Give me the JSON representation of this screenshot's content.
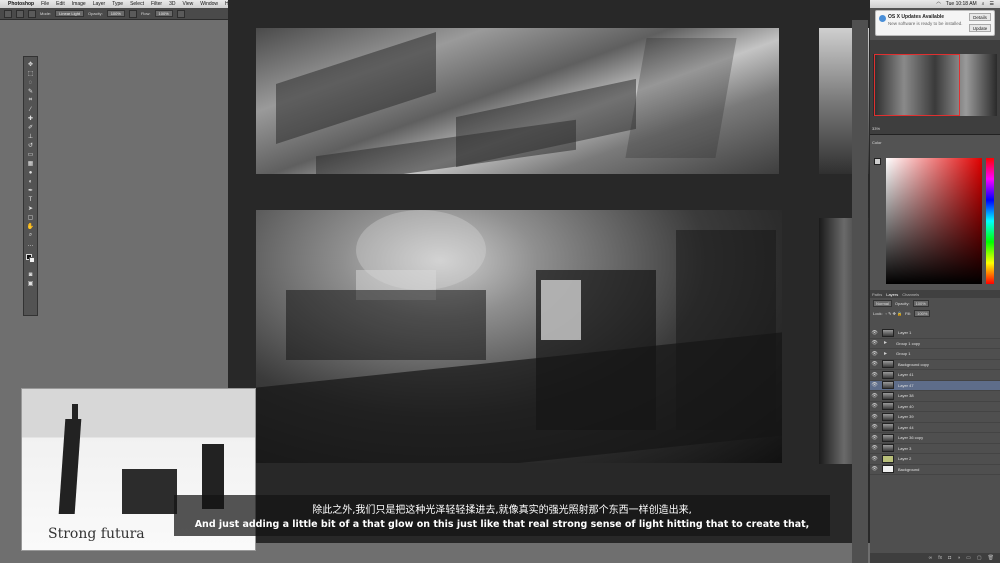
{
  "menubar": {
    "app": "Photoshop",
    "items": [
      "File",
      "Edit",
      "Image",
      "Layer",
      "Type",
      "Select",
      "Filter",
      "3D",
      "View",
      "Window",
      "Help"
    ],
    "clock": "Tue 10:18 AM"
  },
  "options": {
    "mode_label": "Mode:",
    "mode_value": "Linear Light",
    "opacity_label": "Opacity:",
    "opacity_value": "100%",
    "flow_label": "Flow:",
    "flow_value": "100%"
  },
  "notification": {
    "title": "OS X Updates Available",
    "body": "New software is ready to be installed.",
    "btn1": "Details",
    "btn2": "Update"
  },
  "navigator": {
    "zoom": "33%"
  },
  "color_panel": {
    "label": "Color"
  },
  "layers_panel": {
    "tabs": [
      "Paths",
      "Layers",
      "Channels"
    ],
    "blend": "Normal",
    "opacity_label": "Opacity:",
    "opacity_value": "100%",
    "fill_label": "Fill:",
    "fill_value": "100%",
    "lock_label": "Lock:",
    "layers": [
      {
        "name": "Layer 1",
        "kind": "img"
      },
      {
        "name": "Group 1 copy",
        "kind": "folder"
      },
      {
        "name": "Group 1",
        "kind": "folder"
      },
      {
        "name": "Background copy",
        "kind": "img"
      },
      {
        "name": "Layer 41",
        "kind": "img"
      },
      {
        "name": "Layer 47",
        "kind": "img"
      },
      {
        "name": "Layer 38",
        "kind": "img"
      },
      {
        "name": "Layer 40",
        "kind": "img"
      },
      {
        "name": "Layer 39",
        "kind": "img"
      },
      {
        "name": "Layer 44",
        "kind": "img"
      },
      {
        "name": "Layer 36 copy",
        "kind": "img"
      },
      {
        "name": "Layer 3",
        "kind": "img"
      },
      {
        "name": "Layer 2",
        "kind": "green"
      },
      {
        "name": "Background",
        "kind": "white"
      }
    ],
    "selected_index": 5
  },
  "inset": {
    "caption": "Strong futura"
  },
  "subtitles": {
    "zh": "除此之外,我们只是把这种光泽轻轻揉进去,就像真实的强光照射那个东西一样创造出来,",
    "en": "And just adding a little bit of a that glow on this just like that real strong sense of light hitting that to create that,"
  }
}
